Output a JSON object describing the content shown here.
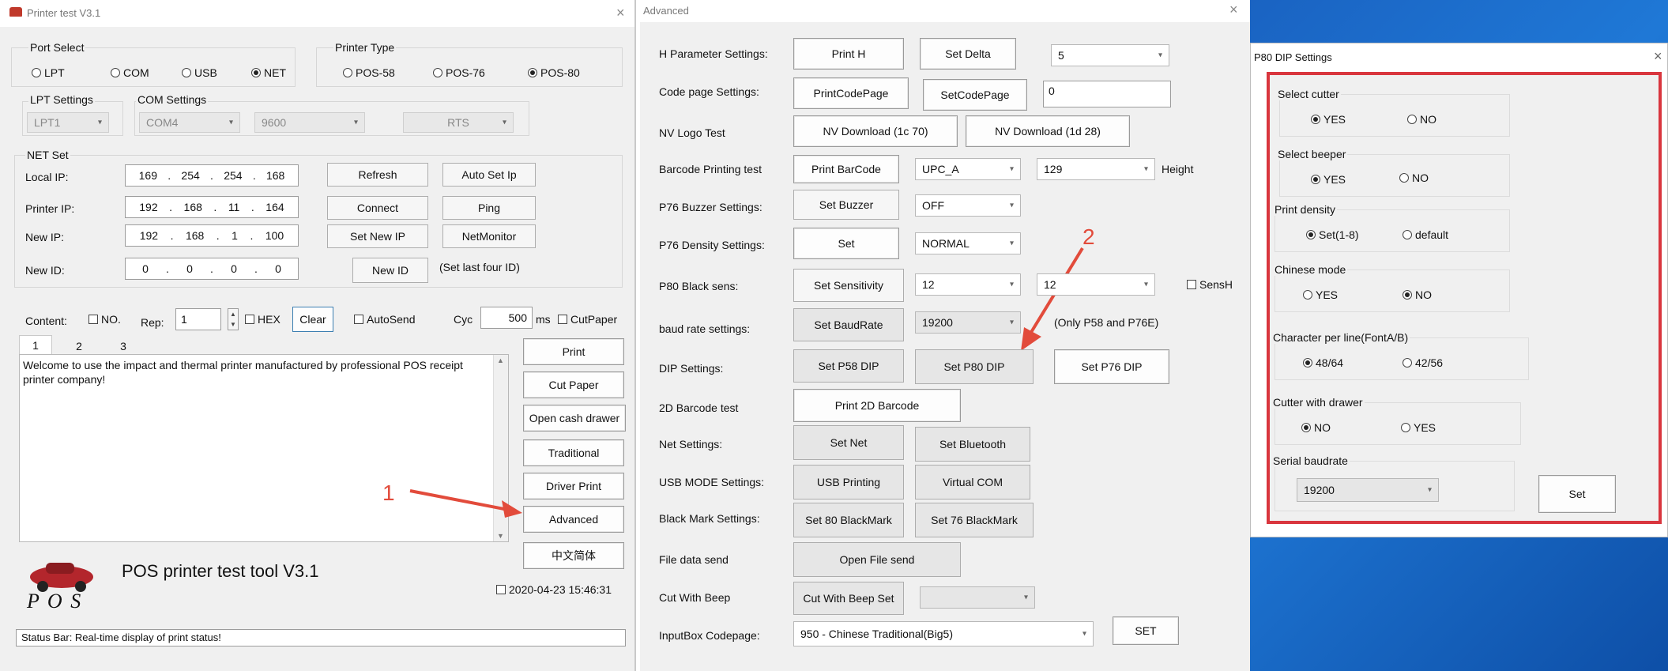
{
  "win1": {
    "title": "Printer test V3.1",
    "close": "×",
    "port_select": {
      "title": "Port Select",
      "options": [
        "LPT",
        "COM",
        "USB",
        "NET"
      ],
      "selected": "NET"
    },
    "printer_type": {
      "title": "Printer Type",
      "options": [
        "POS-58",
        "POS-76",
        "POS-80"
      ],
      "selected": "POS-80"
    },
    "lpt_settings": {
      "title": "LPT Settings",
      "value": "LPT1"
    },
    "com_settings": {
      "title": "COM Settings",
      "port": "COM4",
      "baud": "9600",
      "flow": "RTS"
    },
    "net_set": {
      "title": "NET Set",
      "local_ip_label": "Local IP:",
      "local_ip": [
        "169",
        "254",
        "254",
        "168"
      ],
      "printer_ip_label": "Printer IP:",
      "printer_ip": [
        "192",
        "168",
        "11",
        "164"
      ],
      "new_ip_label": "New IP:",
      "new_ip": [
        "192",
        "168",
        "1",
        "100"
      ],
      "new_id_label": "New ID:",
      "new_id": [
        "0",
        "0",
        "0",
        "0"
      ],
      "refresh": "Refresh",
      "auto_set_ip": "Auto Set Ip",
      "connect": "Connect",
      "ping": "Ping",
      "set_new_ip": "Set New IP",
      "net_monitor": "NetMonitor",
      "new_id_btn": "New ID",
      "new_id_note": "(Set last four ID)"
    },
    "content_row": {
      "content_label": "Content:",
      "no_label": "NO.",
      "rep_label": "Rep:",
      "rep_value": "1",
      "hex_label": "HEX",
      "clear": "Clear",
      "autosend_label": "AutoSend",
      "cyc_label": "Cyc",
      "cyc_value": "500",
      "ms_label": "ms",
      "cutpaper_label": "CutPaper"
    },
    "tabs": [
      "1",
      "2",
      "3"
    ],
    "text_content": "Welcome to use the impact and thermal printer manufactured by professional POS receipt printer company!",
    "buttons": [
      "Print",
      "Cut Paper",
      "Open cash drawer",
      "Traditional",
      "Driver Print",
      "Advanced",
      "中文简体"
    ],
    "logo_text": "P O S",
    "app_name": "POS printer test tool V3.1",
    "datetime": "2020-04-23 15:46:31",
    "status_bar": "Status Bar: Real-time display of print status!",
    "annotation": "1"
  },
  "win2": {
    "title": "Advanced",
    "close": "×",
    "annotation": "2",
    "h_param": {
      "label": "H Parameter Settings:",
      "print_h": "Print H",
      "set_delta": "Set Delta",
      "delta_value": "5"
    },
    "code_page": {
      "label": "Code page Settings:",
      "print": "PrintCodePage",
      "set": "SetCodePage",
      "value": "0"
    },
    "nv_logo": {
      "label": "NV Logo Test",
      "btn1": "NV Download (1c 70)",
      "btn2": "NV Download (1d 28)"
    },
    "barcode": {
      "label": "Barcode Printing test",
      "btn": "Print BarCode",
      "type": "UPC_A",
      "height_value": "129",
      "height_label": "Height"
    },
    "buzzer": {
      "label": "P76 Buzzer Settings:",
      "btn": "Set Buzzer",
      "value": "OFF"
    },
    "density": {
      "label": "P76 Density Settings:",
      "btn": "Set",
      "value": "NORMAL"
    },
    "black_sens": {
      "label": "P80 Black sens:",
      "btn": "Set Sensitivity",
      "value1": "12",
      "value2": "12",
      "sensh_label": "SensH"
    },
    "baud": {
      "label": "baud rate settings:",
      "btn": "Set BaudRate",
      "value": "19200",
      "note": "(Only P58 and P76E)"
    },
    "dip": {
      "label": "DIP Settings:",
      "p58": "Set P58 DIP",
      "p80": "Set P80 DIP",
      "p76": "Set P76 DIP"
    },
    "barcode2d": {
      "label": "2D Barcode test",
      "btn": "Print 2D Barcode"
    },
    "net": {
      "label": "Net Settings:",
      "set_net": "Set Net",
      "set_bt": "Set Bluetooth"
    },
    "usb_mode": {
      "label": "USB MODE Settings:",
      "usb_printing": "USB Printing",
      "virtual_com": "Virtual COM"
    },
    "black_mark": {
      "label": "Black Mark Settings:",
      "set80": "Set 80 BlackMark",
      "set76": "Set 76 BlackMark"
    },
    "file_send": {
      "label": "File data send",
      "btn": "Open File send"
    },
    "cut_beep": {
      "label": "Cut With Beep",
      "btn": "Cut With Beep Set",
      "value": ""
    },
    "input_codepage": {
      "label": "InputBox Codepage:",
      "value": "950 - Chinese Traditional(Big5)",
      "set": "SET"
    }
  },
  "win3": {
    "title": "P80 DIP Settings",
    "close": "×",
    "select_cutter": {
      "title": "Select cutter",
      "yes": "YES",
      "no": "NO",
      "selected": "YES"
    },
    "select_beeper": {
      "title": "Select beeper",
      "yes": "YES",
      "no": "NO",
      "selected": "YES"
    },
    "print_density": {
      "title": "Print density",
      "opt1": "Set(1-8)",
      "opt2": "default",
      "selected": "Set(1-8)"
    },
    "chinese_mode": {
      "title": "Chinese mode",
      "yes": "YES",
      "no": "NO",
      "selected": "NO"
    },
    "char_per_line": {
      "title": "Character per line(FontA/B)",
      "opt1": "48/64",
      "opt2": "42/56",
      "selected": "48/64"
    },
    "cutter_drawer": {
      "title": "Cutter with drawer",
      "no": "NO",
      "yes": "YES",
      "selected": "NO"
    },
    "serial_baud": {
      "title": "Serial baudrate",
      "value": "19200"
    },
    "set": "Set"
  },
  "colors": {
    "desktop": "#1565c8",
    "highlight": "#d9363e",
    "arrow": "#e24b3b",
    "panel": "#f0f0f0"
  }
}
